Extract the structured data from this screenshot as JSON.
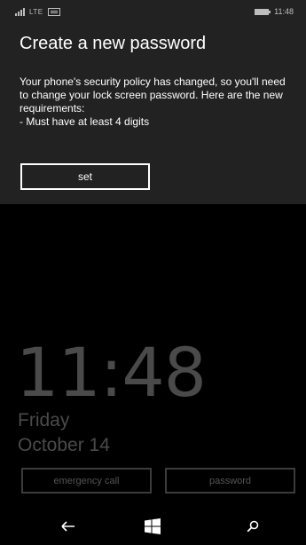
{
  "status_bar": {
    "network": "LTE",
    "time": "11:48"
  },
  "dialog": {
    "title": "Create a new password",
    "body_line1": "Your phone's security policy has changed, so you'll need to change your lock screen password. Here are the new requirements:",
    "body_line2": "- Must have at least 4 digits",
    "set_label": "set"
  },
  "lock_screen": {
    "time": "11:48",
    "day": "Friday",
    "date": "October 14",
    "emergency_label": "emergency call",
    "password_label": "password"
  },
  "nav": {
    "back_icon": "back-arrow-icon",
    "start_icon": "windows-logo-icon",
    "search_icon": "search-icon"
  },
  "colors": {
    "dialog_bg": "#222222",
    "screen_bg": "#000000",
    "dim_text": "#4a4a4a"
  }
}
